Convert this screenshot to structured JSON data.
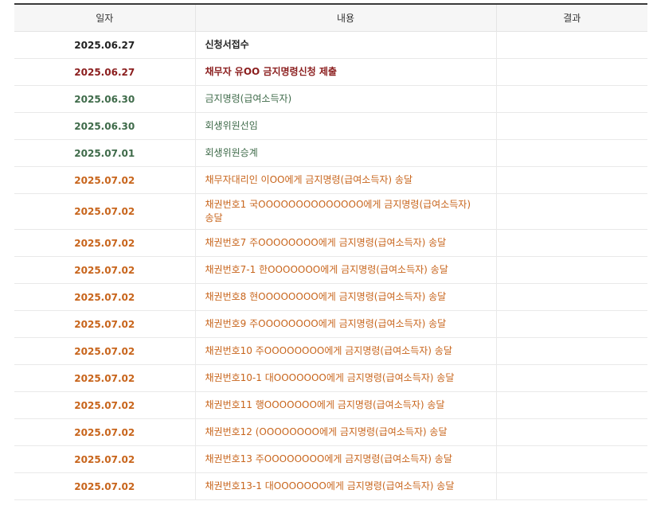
{
  "headers": {
    "date": "일자",
    "content": "내용",
    "result": "결과"
  },
  "rows": [
    {
      "date": "2025.06.27",
      "content": "신청서접수",
      "result": "",
      "style": "black"
    },
    {
      "date": "2025.06.27",
      "content": "채무자 유OO 금지명령신청 제출",
      "result": "",
      "style": "darkred"
    },
    {
      "date": "2025.06.30",
      "content": "금지명령(급여소득자)",
      "result": "",
      "style": "green"
    },
    {
      "date": "2025.06.30",
      "content": "회생위원선임",
      "result": "",
      "style": "green"
    },
    {
      "date": "2025.07.01",
      "content": "회생위원승계",
      "result": "",
      "style": "green"
    },
    {
      "date": "2025.07.02",
      "content": "채무자대리인 이OO에게 금지명령(급여소득자) 송달",
      "result": "",
      "style": "orange"
    },
    {
      "date": "2025.07.02",
      "content": "채권번호1 국OOOOOOOOOOOOOO에게 금지명령(급여소득자) 송달",
      "result": "",
      "style": "orange"
    },
    {
      "date": "2025.07.02",
      "content": "채권번호7 주OOOOOOOO에게 금지명령(급여소득자) 송달",
      "result": "",
      "style": "orange"
    },
    {
      "date": "2025.07.02",
      "content": "채권번호7-1 한OOOOOOO에게 금지명령(급여소득자) 송달",
      "result": "",
      "style": "orange"
    },
    {
      "date": "2025.07.02",
      "content": "채권번호8 현OOOOOOOO에게 금지명령(급여소득자) 송달",
      "result": "",
      "style": "orange"
    },
    {
      "date": "2025.07.02",
      "content": "채권번호9 주OOOOOOOO에게 금지명령(급여소득자) 송달",
      "result": "",
      "style": "orange"
    },
    {
      "date": "2025.07.02",
      "content": "채권번호10 주OOOOOOOO에게 금지명령(급여소득자) 송달",
      "result": "",
      "style": "orange"
    },
    {
      "date": "2025.07.02",
      "content": "채권번호10-1 대OOOOOOO에게 금지명령(급여소득자) 송달",
      "result": "",
      "style": "orange"
    },
    {
      "date": "2025.07.02",
      "content": "채권번호11 행OOOOOOO에게 금지명령(급여소득자) 송달",
      "result": "",
      "style": "orange"
    },
    {
      "date": "2025.07.02",
      "content": "채권번호12 (OOOOOOOO에게 금지명령(급여소득자) 송달",
      "result": "",
      "style": "orange"
    },
    {
      "date": "2025.07.02",
      "content": "채권번호13 주OOOOOOOO에게 금지명령(급여소득자) 송달",
      "result": "",
      "style": "orange"
    },
    {
      "date": "2025.07.02",
      "content": "채권번호13-1 대OOOOOOO에게 금지명령(급여소득자) 송달",
      "result": "",
      "style": "orange"
    }
  ],
  "colors": {
    "black": "#222222",
    "darkred": "#8b1e1e",
    "green": "#3f6b4a",
    "orange": "#c8651c",
    "header_bg": "#f6f6f6",
    "top_border": "#3a3a3a"
  }
}
